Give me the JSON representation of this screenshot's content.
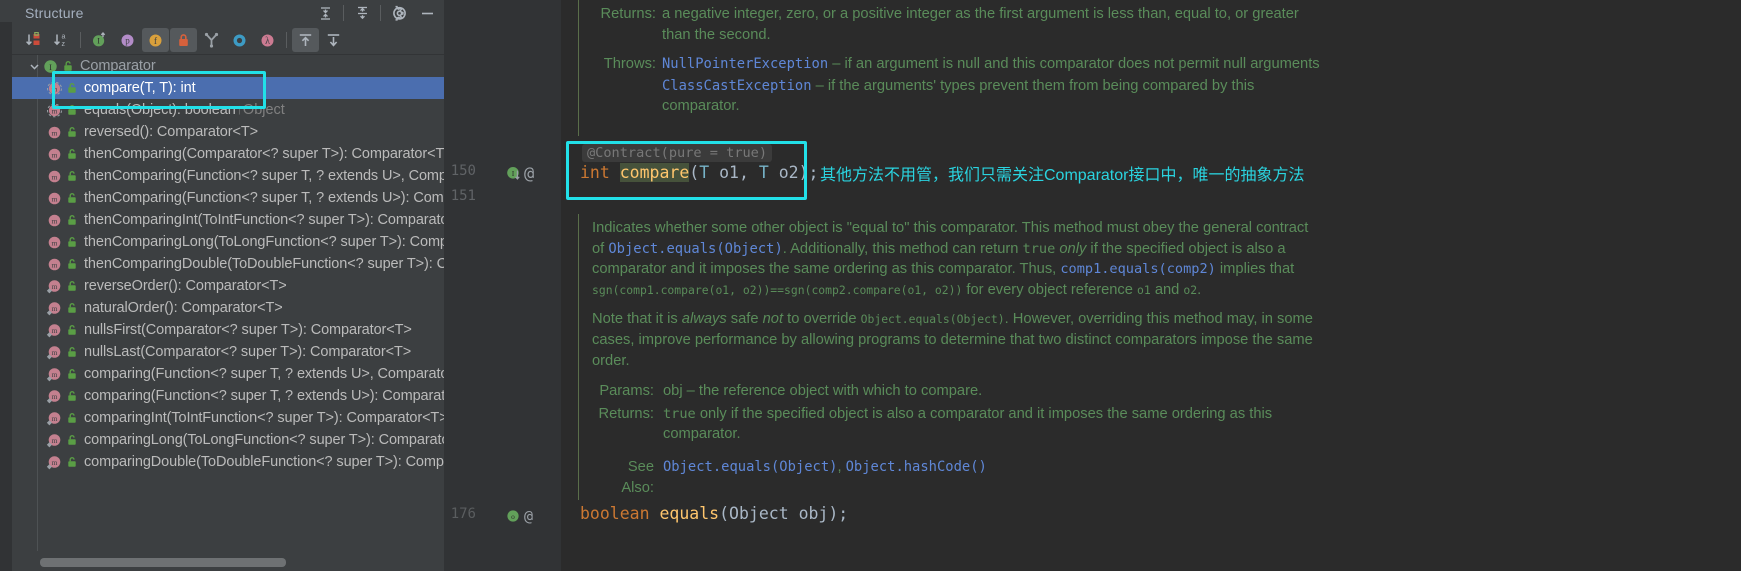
{
  "structure": {
    "title": "Structure",
    "header_actions": [
      {
        "name": "expand-all-icon",
        "label": "Expand All"
      },
      {
        "name": "collapse-all-icon",
        "label": "Collapse All"
      },
      {
        "name": "gear-icon",
        "label": "Settings"
      },
      {
        "name": "minimize-icon",
        "label": "Hide"
      }
    ],
    "toolbar": [
      {
        "name": "sort-by-visibility-icon",
        "label": "Sort by Visibility",
        "active": false
      },
      {
        "name": "sort-alphabetically-icon",
        "label": "Sort Alphabetically",
        "active": false
      },
      {
        "name": "show-inherited-icon",
        "label": "Show Inherited",
        "active": false
      },
      {
        "name": "show-properties-icon",
        "label": "Show Properties",
        "active": false
      },
      {
        "name": "show-fields-icon",
        "label": "Show Fields",
        "active": true
      },
      {
        "name": "show-non-public-icon",
        "label": "Show Non-Public",
        "active": true
      },
      {
        "name": "group-by-implementation-icon",
        "label": "Group Methods by Defining Type",
        "active": false
      },
      {
        "name": "show-anonymous-classes-icon",
        "label": "Show Anonymous Classes",
        "active": false
      },
      {
        "name": "show-lambdas-icon",
        "label": "Show Lambdas",
        "active": false
      },
      {
        "name": "autoscroll-to-source-icon",
        "label": "Autoscroll to Source",
        "active": true
      },
      {
        "name": "autoscroll-from-source-icon",
        "label": "Autoscroll from Source",
        "active": false
      }
    ],
    "tree": [
      {
        "label": "Comparator",
        "icon": "interface-icon",
        "kind": "interface",
        "selected": false,
        "level": 0,
        "expanded": true,
        "inherited": ""
      },
      {
        "label": "compare(T, T): int",
        "icon": "method-abstract-icon",
        "kind": "abstract-method",
        "selected": true,
        "level": 1,
        "inherited": ""
      },
      {
        "label": "equals(Object): boolean",
        "icon": "method-abstract-icon",
        "kind": "abstract-method",
        "selected": false,
        "level": 1,
        "inherited": "↑Object"
      },
      {
        "label": "reversed(): Comparator<T>",
        "icon": "method-icon",
        "kind": "method",
        "selected": false,
        "level": 1,
        "inherited": ""
      },
      {
        "label": "thenComparing(Comparator<? super T>): Comparator<T>",
        "icon": "method-icon",
        "kind": "method",
        "selected": false,
        "level": 1,
        "inherited": ""
      },
      {
        "label": "thenComparing(Function<? super T, ? extends U>, Comparator<? super U>): Comparator<T>",
        "icon": "method-icon",
        "kind": "method",
        "selected": false,
        "level": 1,
        "inherited": ""
      },
      {
        "label": "thenComparing(Function<? super T, ? extends U>): Comparator<T>",
        "icon": "method-icon",
        "kind": "method",
        "selected": false,
        "level": 1,
        "inherited": ""
      },
      {
        "label": "thenComparingInt(ToIntFunction<? super T>): Comparator<T>",
        "icon": "method-icon",
        "kind": "method",
        "selected": false,
        "level": 1,
        "inherited": ""
      },
      {
        "label": "thenComparingLong(ToLongFunction<? super T>): Comparator<T>",
        "icon": "method-icon",
        "kind": "method",
        "selected": false,
        "level": 1,
        "inherited": ""
      },
      {
        "label": "thenComparingDouble(ToDoubleFunction<? super T>): Comparator<T>",
        "icon": "method-icon",
        "kind": "method",
        "selected": false,
        "level": 1,
        "inherited": ""
      },
      {
        "label": "reverseOrder(): Comparator<T>",
        "icon": "method-static-icon",
        "kind": "static-method",
        "selected": false,
        "level": 1,
        "inherited": ""
      },
      {
        "label": "naturalOrder(): Comparator<T>",
        "icon": "method-static-icon",
        "kind": "static-method",
        "selected": false,
        "level": 1,
        "inherited": ""
      },
      {
        "label": "nullsFirst(Comparator<? super T>): Comparator<T>",
        "icon": "method-static-icon",
        "kind": "static-method",
        "selected": false,
        "level": 1,
        "inherited": ""
      },
      {
        "label": "nullsLast(Comparator<? super T>): Comparator<T>",
        "icon": "method-static-icon",
        "kind": "static-method",
        "selected": false,
        "level": 1,
        "inherited": ""
      },
      {
        "label": "comparing(Function<? super T, ? extends U>, Comparator<? super U>): Comparator<T>",
        "icon": "method-static-icon",
        "kind": "static-method",
        "selected": false,
        "level": 1,
        "inherited": ""
      },
      {
        "label": "comparing(Function<? super T, ? extends U>): Comparator<T>",
        "icon": "method-static-icon",
        "kind": "static-method",
        "selected": false,
        "level": 1,
        "inherited": ""
      },
      {
        "label": "comparingInt(ToIntFunction<? super T>): Comparator<T>",
        "icon": "method-static-icon",
        "kind": "static-method",
        "selected": false,
        "level": 1,
        "inherited": ""
      },
      {
        "label": "comparingLong(ToLongFunction<? super T>): Comparator<T>",
        "icon": "method-static-icon",
        "kind": "static-method",
        "selected": false,
        "level": 1,
        "inherited": ""
      },
      {
        "label": "comparingDouble(ToDoubleFunction<? super T>): Comparator<T>",
        "icon": "method-static-icon",
        "kind": "static-method",
        "selected": false,
        "level": 1,
        "inherited": ""
      }
    ]
  },
  "editor": {
    "line_numbers": [
      "150",
      "151",
      "176"
    ],
    "gutter_markers": [
      {
        "name": "implemented-method-marker",
        "label": "I"
      },
      {
        "name": "annotation-marker",
        "label": "@"
      }
    ],
    "inlay_hint": "@Contract(pure = true)",
    "code_line": {
      "keyword": "int",
      "method": "compare",
      "open": "(",
      "param1_type": "T",
      "param1_name": "o1",
      "comma": ", ",
      "param2_type": "T",
      "param2_name": "o2",
      "close": ");"
    },
    "annotation_note": "其他方法不用管，我们只需关注Comparator接口中，唯一的抽象方法",
    "bottom_code": {
      "type": "boolean",
      "method": "equals",
      "rest": "(Object obj);"
    }
  },
  "javadoc_top": {
    "returns_label": "Returns:",
    "returns_text": "a negative integer, zero, or a positive integer as the first argument is less than, equal to, or greater than the second.",
    "throws_label": "Throws:",
    "throws": [
      {
        "type": "NullPointerException",
        "desc": "– if an argument is null and this comparator does not permit null arguments"
      },
      {
        "type": "ClassCastException",
        "desc": "– if the arguments' types prevent them from being compared by this comparator."
      }
    ]
  },
  "javadoc_bottom": {
    "para1_a": "Indicates whether some other object is \"equal to\" this comparator. This method must obey the general contract of ",
    "para1_link": "Object.equals(Object)",
    "para1_b": ". Additionally, this method can return ",
    "para1_true": "true",
    "para1_only": "only",
    "para1_c": " if the specified object is also a comparator and it imposes the same ordering as this comparator. Thus, ",
    "para1_code1": "comp1.equals(comp2)",
    "para1_d": " implies that ",
    "para1_formula": "sgn(comp1.compare(o1, o2))==sgn(comp2.compare(o1, o2))",
    "para1_e": " for every object reference ",
    "para1_o1": "o1",
    "para1_and": " and ",
    "para1_o2": "o2",
    "para1_dot": ".",
    "para2_a": "Note that it is ",
    "para2_always": "always",
    "para2_b": " safe ",
    "para2_not": "not",
    "para2_c": " to override ",
    "para2_code": "Object.equals(Object)",
    "para2_d": ". However, overriding this method may, in some cases, improve performance by allowing programs to determine that two distinct comparators impose the same order.",
    "params_label": "Params:",
    "params_text": "obj – the reference object with which to compare.",
    "returns_label": "Returns:",
    "returns_true": "true",
    "returns_text": " only if the specified object is also a comparator and it imposes the same ordering as this comparator.",
    "seealso_label": "See Also:",
    "seealso_links": [
      "Object.equals(Object)",
      "Object.hashCode()"
    ]
  },
  "colors": {
    "accent_cyan": "#22e0e8",
    "selection_blue": "#4b6eaf",
    "javadoc_green": "#5a8c5a",
    "link_blue": "#5f87d7",
    "panel_bg": "#3c3f41",
    "editor_bg": "#2b2b2b",
    "keyword_orange": "#cc7832",
    "method_yellow": "#ffc66d"
  }
}
